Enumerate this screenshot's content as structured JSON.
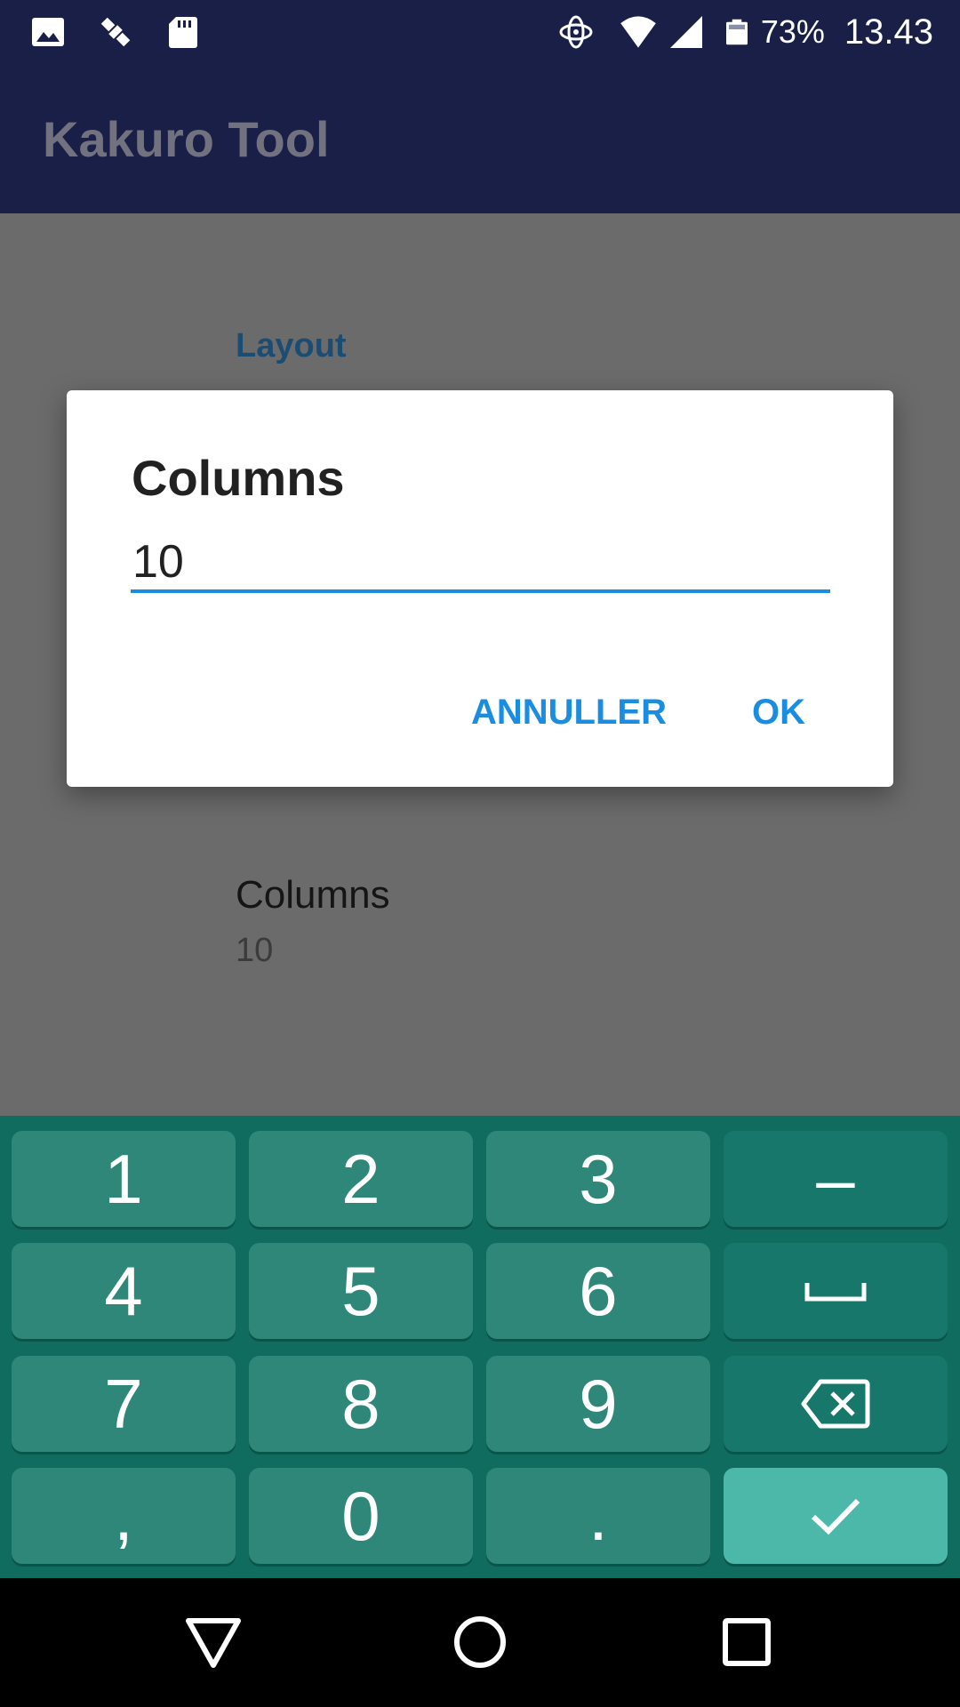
{
  "status_bar": {
    "battery_percent": "73%",
    "time": "13.43",
    "icons": [
      "image-icon",
      "satellite-icon",
      "sd-card-icon",
      "data-sync-icon",
      "wifi-icon",
      "signal-icon",
      "battery-icon"
    ]
  },
  "app_bar": {
    "title": "Kakuro Tool"
  },
  "settings": {
    "section_header": "Layout",
    "columns_pref": {
      "title": "Columns",
      "summary": "10"
    }
  },
  "dialog": {
    "title": "Columns",
    "input_value": "10",
    "cancel_label": "ANNULLER",
    "ok_label": "OK"
  },
  "keyboard": {
    "rows": [
      [
        "1",
        "2",
        "3",
        "–"
      ],
      [
        "4",
        "5",
        "6",
        "space"
      ],
      [
        "7",
        "8",
        "9",
        "backspace"
      ],
      [
        ",",
        "0",
        ".",
        "enter"
      ]
    ]
  },
  "navigation": {
    "buttons": [
      "back-icon",
      "home-icon",
      "recents-icon"
    ]
  },
  "colors": {
    "app_bar": "#1a1f48",
    "accent": "#1a8de0",
    "keyboard_bg": "#0f6c5f",
    "key": "#2e8778",
    "enter_key": "#4cb8aa"
  }
}
